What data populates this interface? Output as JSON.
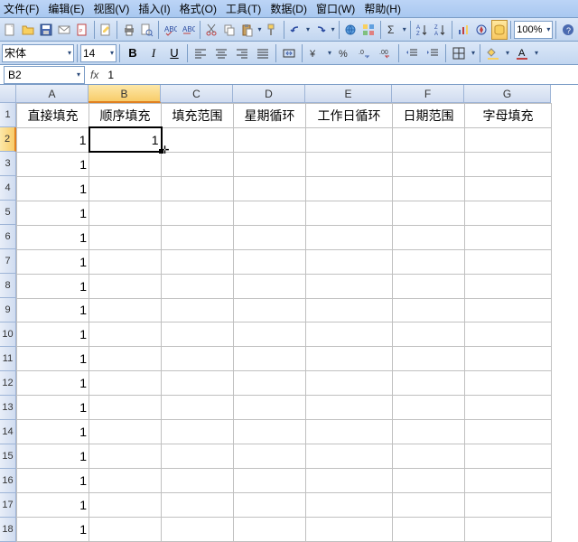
{
  "menus": {
    "file": "文件(F)",
    "edit": "编辑(E)",
    "view": "视图(V)",
    "insert": "插入(I)",
    "format": "格式(O)",
    "tools": "工具(T)",
    "data": "数据(D)",
    "window": "窗口(W)",
    "help": "帮助(H)"
  },
  "toolbar1": {
    "zoom": "100%"
  },
  "toolbar2": {
    "fontname": "宋体",
    "fontsize": "14",
    "bold": "B",
    "italic": "I",
    "underline": "U"
  },
  "formulabar": {
    "namebox": "B2",
    "fx": "fx",
    "formula": "1"
  },
  "col_letters": [
    "A",
    "B",
    "C",
    "D",
    "E",
    "F",
    "G"
  ],
  "row_numbers": [
    "1",
    "2",
    "3",
    "4",
    "5",
    "6",
    "7",
    "8",
    "9",
    "10",
    "11",
    "12",
    "13",
    "14",
    "15",
    "16",
    "17",
    "18"
  ],
  "headers": {
    "A": "直接填充",
    "B": "顺序填充",
    "C": "填充范围",
    "D": "星期循环",
    "E": "工作日循环",
    "F": "日期范围",
    "G": "字母填充"
  },
  "colA_values": [
    "1",
    "1",
    "1",
    "1",
    "1",
    "1",
    "1",
    "1",
    "1",
    "1",
    "1",
    "1",
    "1",
    "1",
    "1",
    "1",
    "1"
  ],
  "B2_value": "1",
  "active_cell": "B2",
  "chart_data": null
}
